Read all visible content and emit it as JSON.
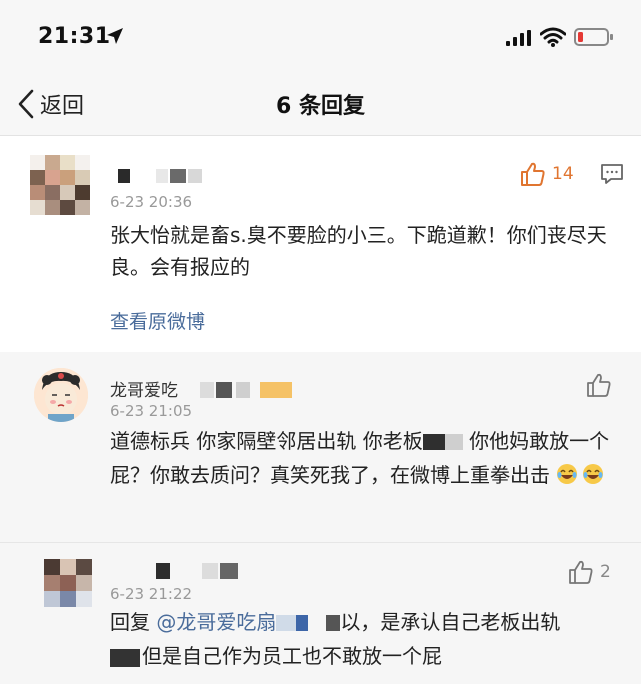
{
  "status_bar": {
    "time": "21:31"
  },
  "nav": {
    "back_label": "返回",
    "title": "6 条回复"
  },
  "main_comment": {
    "time": "6-23 20:36",
    "like_count": "14",
    "text": "张大怡就是畜s.臭不要脸的小三。下跪道歉！你们丧尽天良。会有报应的",
    "link": "查看原微博"
  },
  "replies": [
    {
      "name": "龙哥爱吃",
      "time": "6-23 21:05",
      "text_a": "道德标兵 你家隔壁邻居出轨 你老板",
      "text_b": " 你他妈敢放一个屁？你敢去质问？真笑死我了，在微博上重拳出击"
    },
    {
      "time": "6-23 21:22",
      "like_count": "2",
      "reply_prefix": "回复",
      "mention": "@龙哥爱吃扇",
      "text_a": "以，是承认自己老板出轨",
      "text_b": "但是自己作为员工也不敢放一个屁"
    }
  ],
  "colors": {
    "accent_orange": "#e07530",
    "link_blue": "#4a6c9b"
  },
  "icons": [
    "location-arrow-icon",
    "signal-icon",
    "wifi-icon",
    "battery-low-icon",
    "back-chevron-icon",
    "thumbs-up-icon",
    "comment-icon",
    "laughing-crying-emoji"
  ]
}
